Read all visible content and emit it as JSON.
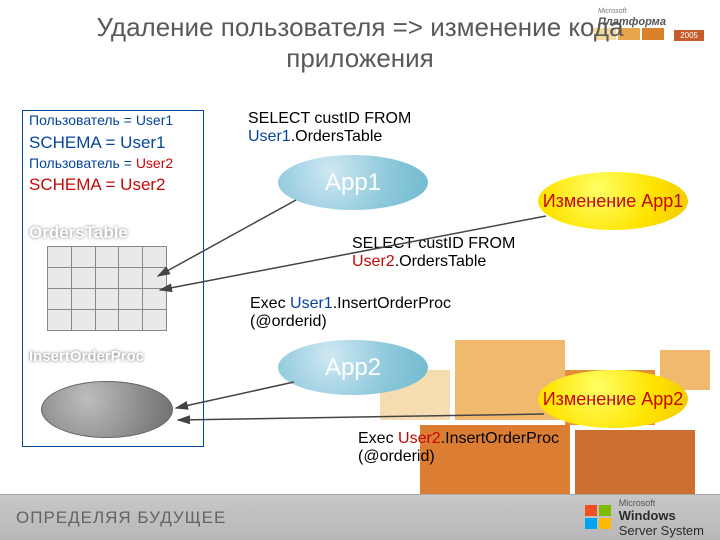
{
  "title": "Удаление пользователя => изменение кода приложения",
  "logo": {
    "ms": "Microsoft",
    "platform": "Платформа",
    "year": "2005"
  },
  "db": {
    "line1_label": "Пользователь = ",
    "line1_val": "User1",
    "line2": "SCHEMA = User1",
    "line3_label": "Пользователь  = ",
    "line3_val": "User2",
    "line4": "SCHEMA = User2",
    "tableName": "OrdersTable",
    "procName": "InsertOrderProc"
  },
  "sql": {
    "q1_a": "SELECT custID FROM ",
    "q1_u": "User1",
    "q1_b": ".OrdersTable",
    "q2_a": "SELECT custID FROM ",
    "q2_u": "User2",
    "q2_b": ".OrdersTable",
    "e1_a": "Exec ",
    "e1_u": "User1",
    "e1_b": ".InsertOrderProc (@orderid)",
    "e2_a": "Exec ",
    "e2_u": "User2",
    "e2_b": ".InsertOrderProc (@orderid)"
  },
  "apps": {
    "app1": "App1",
    "app2": "App2"
  },
  "changes": {
    "c1": "Изменение App1",
    "c2": "Изменение App2"
  },
  "footer": {
    "left": "ОПРЕДЕЛЯЯ БУДУЩЕЕ",
    "right_ms": "Microsoft",
    "right_a": "Windows",
    "right_b": "Server System"
  }
}
